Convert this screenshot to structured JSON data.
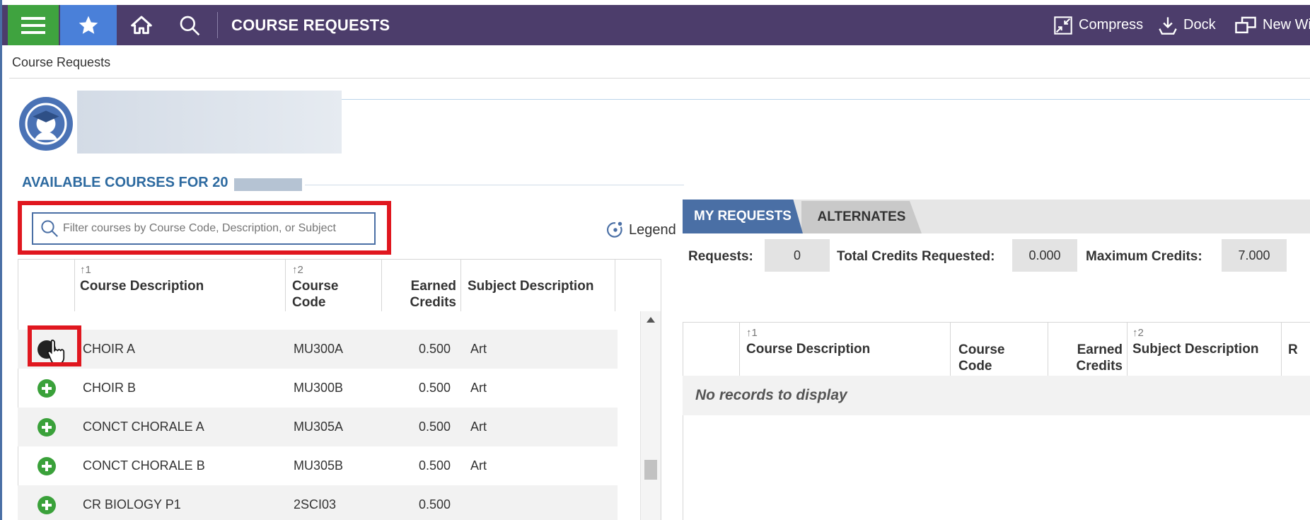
{
  "topbar": {
    "title": "COURSE REQUESTS",
    "actions": [
      {
        "label": "Compress",
        "icon": "compress-icon"
      },
      {
        "label": "Dock",
        "icon": "dock-icon"
      },
      {
        "label": "New Wi",
        "icon": "new-window-icon"
      }
    ],
    "colors": {
      "bar": "#4c3d6b",
      "menu": "#3fa33f",
      "star": "#4a80d9"
    }
  },
  "breadcrumb": "Course Requests",
  "available": {
    "title": "AVAILABLE COURSES FOR 20",
    "filter_placeholder": "Filter courses by Course Code, Description, or Subject",
    "legend_label": "Legend",
    "columns": [
      {
        "sort": "1",
        "label": "Course Description"
      },
      {
        "sort": "2",
        "label": "Course Code"
      },
      {
        "sort": "",
        "label": "Earned Credits"
      },
      {
        "sort": "",
        "label": "Subject Description"
      }
    ],
    "rows": [
      {
        "description": "CHOIR A",
        "code": "MU300A",
        "credits": "0.500",
        "subject": "Art"
      },
      {
        "description": "CHOIR B",
        "code": "MU300B",
        "credits": "0.500",
        "subject": "Art"
      },
      {
        "description": "CONCT CHORALE A",
        "code": "MU305A",
        "credits": "0.500",
        "subject": "Art"
      },
      {
        "description": "CONCT CHORALE B",
        "code": "MU305B",
        "credits": "0.500",
        "subject": "Art"
      },
      {
        "description": "CR BIOLOGY P1",
        "code": "2SCI03",
        "credits": "0.500",
        "subject": ""
      }
    ]
  },
  "requests": {
    "tabs": [
      "MY REQUESTS",
      "ALTERNATES"
    ],
    "stats": {
      "requests_label": "Requests:",
      "requests_value": "0",
      "credits_label": "Total Credits Requested:",
      "credits_value": "0.000",
      "max_label": "Maximum Credits:",
      "max_value": "7.000"
    },
    "columns": [
      {
        "sort": "1",
        "label": "Course Description"
      },
      {
        "sort": "",
        "label": "Course Code"
      },
      {
        "sort": "",
        "label": "Earned Credits"
      },
      {
        "sort": "2",
        "label": "Subject Description"
      },
      {
        "sort": "",
        "label": "R"
      }
    ],
    "empty_text": "No records to display"
  }
}
